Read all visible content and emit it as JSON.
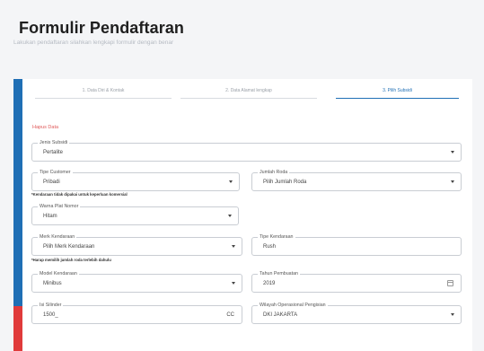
{
  "header": {
    "title": "Formulir Pendaftaran",
    "subtitle": "Lakukan pendaftaran silahkan lengkapi formulir dengan benar"
  },
  "steps": [
    {
      "label": "1.  Data Diri & Kontak",
      "active": false
    },
    {
      "label": "2.  Data Alamat lengkap",
      "active": false
    },
    {
      "label": "3.  Pilih Subsidi",
      "active": true
    }
  ],
  "form": {
    "hapus_label": "Hapus Data",
    "jenis_subsidi": {
      "label": "Jenis Subsidi",
      "value": "Pertalite"
    },
    "tipe_customer": {
      "label": "Tipe Customer",
      "value": "Pribadi"
    },
    "jumlah_roda": {
      "label": "Jumlah Roda",
      "value": "Pilih Jumlah Roda"
    },
    "note_komersial": "*Kendaraan tidak dipakai untuk keperluan komersial",
    "warna_plat": {
      "label": "Warna Plat Nomor",
      "value": "Hitam"
    },
    "merk_kendaraan": {
      "label": "Merk Kendaraan",
      "value": "Pilih Merk Kendaraan"
    },
    "tipe_kendaraan": {
      "label": "Tipe Kendaraan",
      "value": "Rush"
    },
    "note_merk": "*Harap memilih jumlah roda terlebih dahulu",
    "model_kendaraan": {
      "label": "Model Kendaraan",
      "value": "Minibus"
    },
    "tahun_pembuatan": {
      "label": "Tahun Pembuatan",
      "value": "2019"
    },
    "isi_silinder": {
      "label": "Isi Silinder",
      "value": "1500_",
      "suffix": "CC"
    },
    "wilayah": {
      "label": "Wilayah Operasional Pengisian",
      "value": "DKI JAKARTA"
    }
  },
  "colors": {
    "accent_blue": "#1f6fb5",
    "accent_red": "#e03b3b",
    "link_red": "#e05a5a"
  }
}
